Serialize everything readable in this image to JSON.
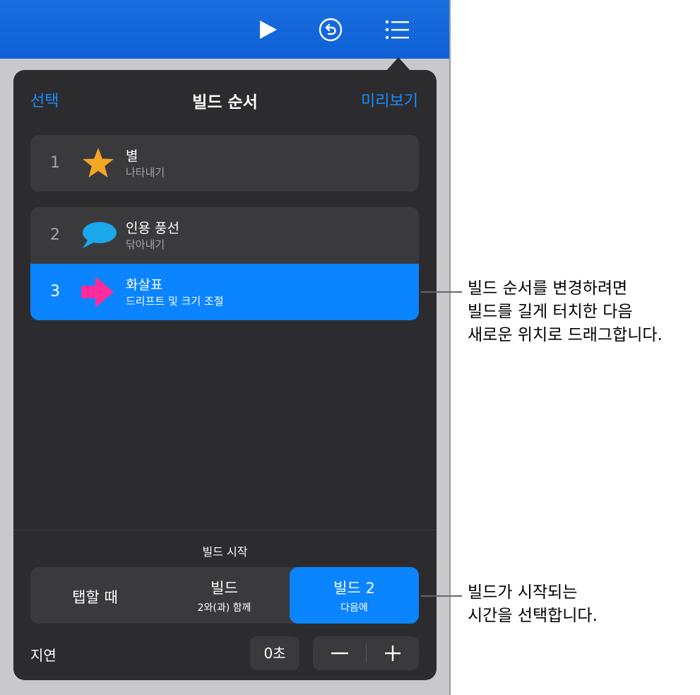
{
  "popover": {
    "header": {
      "left_action": "선택",
      "title": "빌드 순서",
      "right_action": "미리보기"
    },
    "builds": [
      {
        "number": "1",
        "name": "별",
        "effect": "나타내기",
        "icon": "star-icon",
        "color": "#f5a623"
      },
      {
        "number": "2",
        "name": "인용 풍선",
        "effect": "닦아내기",
        "icon": "speech-bubble-icon",
        "color": "#1aa7ec"
      },
      {
        "number": "3",
        "name": "화살표",
        "effect": "드리프트 및 크기 조절",
        "icon": "arrow-icon",
        "color": "#ff2d9b"
      }
    ],
    "start_section": {
      "label": "빌드 시작",
      "options": [
        {
          "label": "탭할 때",
          "sub": ""
        },
        {
          "label": "빌드",
          "sub": "2와(과) 함께"
        },
        {
          "label": "빌드 2",
          "sub": "다음에"
        }
      ],
      "selected_index": 2
    },
    "delay": {
      "label": "지연",
      "value": "0초",
      "minus": "−",
      "plus": "+"
    }
  },
  "toolbar": {
    "icons": [
      "play-icon",
      "undo-icon",
      "build-list-icon"
    ]
  },
  "callouts": {
    "reorder": [
      "빌드 순서를 변경하려면",
      "빌드를 길게 터치한 다음",
      "새로운 위치로 드래그합니다."
    ],
    "timing": [
      "빌드가 시작되는",
      "시간을 선택합니다."
    ]
  },
  "colors": {
    "accent": "#0a84ff",
    "topbar": "#1166dd",
    "panel": "#2c2c2e",
    "row": "#3a3a3c"
  }
}
